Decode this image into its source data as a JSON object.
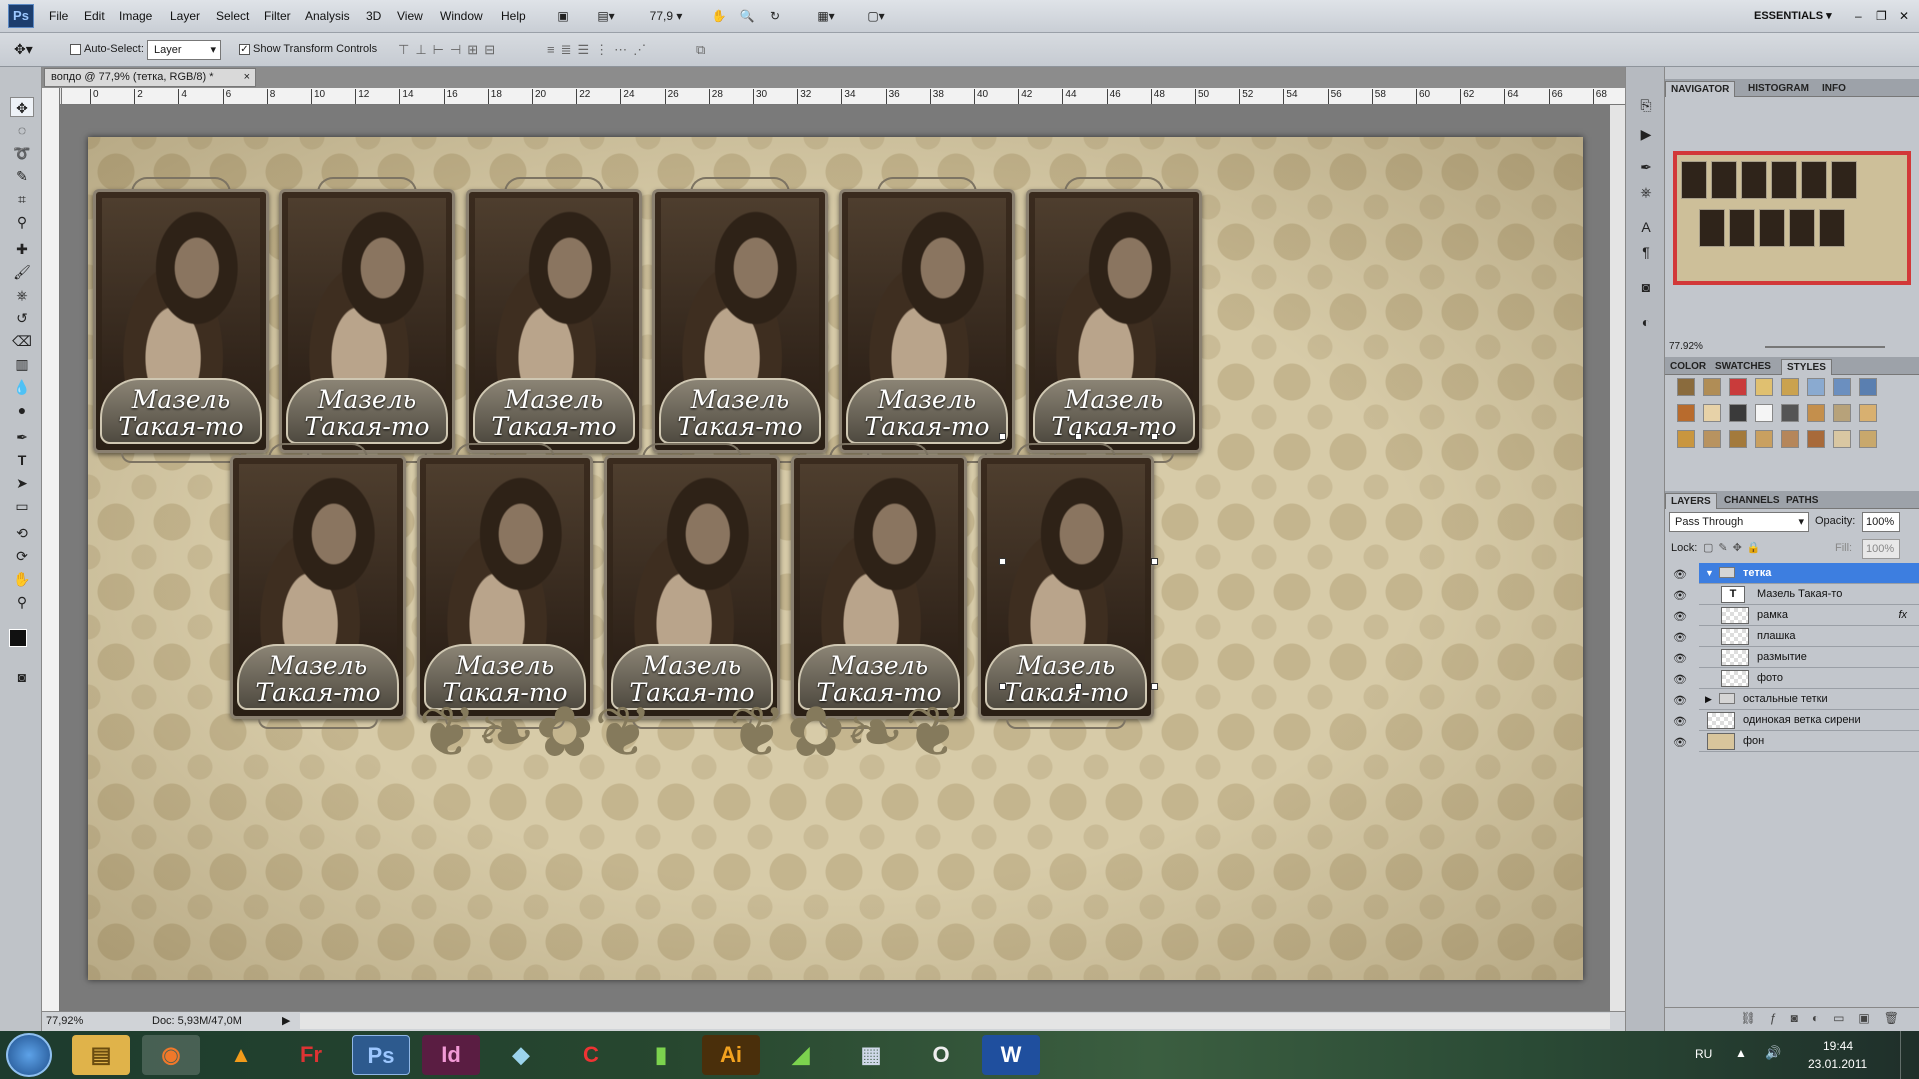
{
  "app": {
    "logo": "Ps"
  },
  "menu": [
    "File",
    "Edit",
    "Image",
    "Layer",
    "Select",
    "Filter",
    "Analysis",
    "3D",
    "View",
    "Window",
    "Help"
  ],
  "toolbar": {
    "zoom_value": "77,9",
    "workspace": "ESSENTIALS"
  },
  "options": {
    "auto_select_label": "Auto-Select:",
    "auto_select_value": "Layer",
    "show_transform_label": "Show Transform Controls"
  },
  "document": {
    "tab_title": "вопдо @ 77,9% (тетка, RGB/8) *"
  },
  "ruler": {
    "h_ticks": [
      "0",
      "2",
      "4",
      "6",
      "8",
      "10",
      "12",
      "14",
      "16",
      "18",
      "20",
      "22",
      "24",
      "26",
      "28",
      "30",
      "32",
      "34",
      "36",
      "38",
      "40",
      "42",
      "44",
      "46",
      "48",
      "50",
      "52",
      "54",
      "56",
      "58",
      "60",
      "62",
      "64",
      "66",
      "68"
    ]
  },
  "cards": {
    "line1": "Мазель",
    "line2": "Такая-то"
  },
  "status": {
    "zoom": "77,92%",
    "doc": "Doc: 5,93M/47,0M"
  },
  "navigator": {
    "tabs": [
      "NAVIGATOR",
      "HISTOGRAM",
      "INFO"
    ],
    "zoom": "77.92%"
  },
  "styles": {
    "tabs": [
      "COLOR",
      "SWATCHES",
      "STYLES"
    ]
  },
  "layers_panel": {
    "tabs": [
      "LAYERS",
      "CHANNELS",
      "PATHS"
    ],
    "blend_mode": "Pass Through",
    "opacity_label": "Opacity:",
    "opacity_value": "100%",
    "lock_label": "Lock:",
    "fill_label": "Fill:",
    "fill_value": "100%",
    "layers": [
      {
        "name": "тетка",
        "type": "group",
        "selected": true
      },
      {
        "name": "Мазель Такая-то",
        "type": "text"
      },
      {
        "name": "рамка",
        "type": "pixel",
        "fx": "fx"
      },
      {
        "name": "плашка",
        "type": "pixel"
      },
      {
        "name": "размытие",
        "type": "pixel"
      },
      {
        "name": "фото",
        "type": "pixel"
      },
      {
        "name": "остальные тетки",
        "type": "group"
      },
      {
        "name": "одинокая ветка сирени",
        "type": "pixel"
      },
      {
        "name": "фон",
        "type": "pixel"
      }
    ]
  },
  "taskbar": {
    "apps": [
      "Ps",
      "Id",
      "Ai"
    ],
    "lang": "RU",
    "time": "19:44",
    "date": "23.01.2011"
  },
  "colors": {
    "selected_layer": "#3d7ee0",
    "nav_frame": "#d23838",
    "menubar": "#d5dae0"
  }
}
